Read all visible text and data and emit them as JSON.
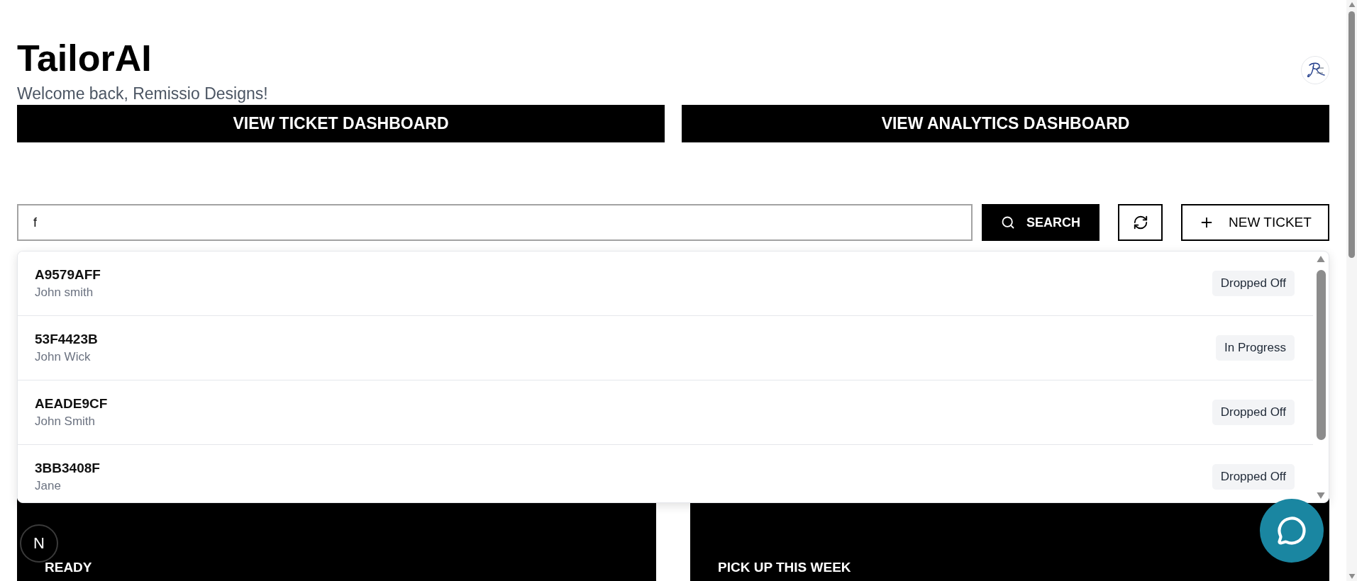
{
  "header": {
    "title": "TailorAI",
    "subtitle": "Welcome back, Remissio Designs!",
    "buttons": [
      {
        "label": "VIEW TICKET DASHBOARD"
      },
      {
        "label": "VIEW ANALYTICS DASHBOARD"
      }
    ]
  },
  "search": {
    "value": "f",
    "button": "SEARCH",
    "new_ticket": "NEW TICKET"
  },
  "results": [
    {
      "id": "A9579AFF",
      "customer": "John smith",
      "status": "Dropped Off"
    },
    {
      "id": "53F4423B",
      "customer": "John Wick",
      "status": "In Progress"
    },
    {
      "id": "AEADE9CF",
      "customer": "John Smith",
      "status": "Dropped Off"
    },
    {
      "id": "3BB3408F",
      "customer": "Jane",
      "status": "Dropped Off"
    }
  ],
  "cards": [
    {
      "label": "READY"
    },
    {
      "label": "PICK UP THIS WEEK"
    }
  ],
  "dev_badge": {
    "label": "N"
  }
}
